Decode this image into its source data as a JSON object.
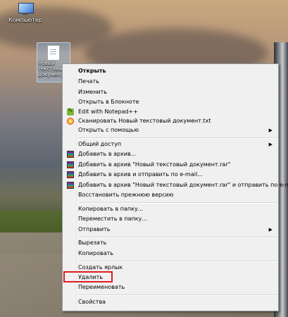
{
  "desktop": {
    "computer_label": "Компьютер",
    "file_label": "Новый текстовый докумен..."
  },
  "menu": {
    "open": "Открыть",
    "print": "Печать",
    "edit": "Изменить",
    "open_notepad": "Открыть в Блокноте",
    "edit_npp": "Edit with Notepad++",
    "scan": "Сканировать Новый текстовый документ.txt",
    "open_with": "Открыть с помощью",
    "share": "Общий доступ",
    "add_archive": "Добавить в архив...",
    "add_rar": "Добавить в архив \"Новый текстовый документ.rar\"",
    "add_email": "Добавить в архив и отправить по e-mail...",
    "add_rar_email": "Добавить в архив \"Новый текстовый документ.rar\" и отправить по e-mail",
    "restore": "Восстановить прежнюю версию",
    "copy_to": "Копировать в папку...",
    "move_to": "Переместить в папку...",
    "send_to": "Отправить",
    "cut": "Вырезать",
    "copy": "Копировать",
    "shortcut": "Создать ярлык",
    "delete": "Удалить",
    "rename": "Переименовать",
    "properties": "Свойства"
  },
  "colors": {
    "highlight": "#e01b24",
    "menu_bg": "#f0f0f0"
  },
  "icons": {
    "npp": "notepad-plus-plus-icon",
    "scan": "antivirus-icon",
    "archive": "winrar-icon"
  }
}
